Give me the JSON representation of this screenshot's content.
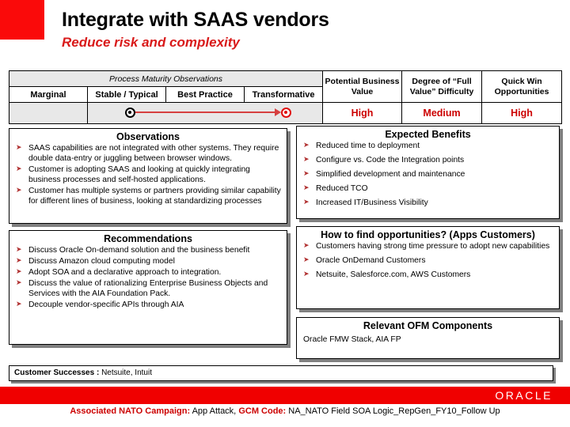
{
  "header": {
    "title": "Integrate with SAAS vendors",
    "subtitle": "Reduce risk and complexity",
    "accent_color": "#fa0a0a",
    "subtitle_color": "#d91a1a"
  },
  "maturity_table": {
    "group_header": "Process Maturity Observations",
    "stages": [
      "Marginal",
      "Stable / Typical",
      "Best Practice",
      "Transformative"
    ],
    "metric_headers": [
      "Potential Business Value",
      "Degree of “Full Value” Difficulty",
      "Quick Win Opportunities"
    ],
    "metric_values": [
      "High",
      "Medium",
      "High"
    ],
    "metric_value_color": "#cc0000",
    "current_stage": "Stable / Typical",
    "target_stage": "Transformative",
    "current_marker": "black-dot-marker",
    "target_marker": "red-dot-marker",
    "arrow": "progress-arrow"
  },
  "observations": {
    "title": "Observations",
    "items": [
      "SAAS capabilities are not integrated with other systems. They require double data-entry or juggling between browser windows.",
      "Customer is adopting SAAS and looking at quickly integrating business processes and self-hosted applications.",
      "Customer has multiple systems or partners providing similar capability for different lines of business, looking at standardizing processes"
    ]
  },
  "expected_benefits": {
    "title": "Expected Benefits",
    "items": [
      "Reduced time to deployment",
      "Configure vs. Code the Integration points",
      "Simplified development and maintenance",
      "Reduced TCO",
      "Increased IT/Business Visibility"
    ]
  },
  "recommendations": {
    "title": "Recommendations",
    "items": [
      "Discuss Oracle On-demand solution and the business benefit",
      "Discuss Amazon cloud computing model",
      "Adopt SOA and a declarative approach to integration.",
      "Discuss the value of rationalizing Enterprise Business Objects and Services with the AIA Foundation Pack.",
      "Decouple vendor-specific APIs through AIA"
    ]
  },
  "opportunities": {
    "title": "How to find opportunities? (Apps Customers)",
    "items": [
      "Customers having strong time pressure to adopt new capabilities",
      "Oracle OnDemand Customers",
      "Netsuite, Salesforce.com, AWS Customers"
    ]
  },
  "ofm_components": {
    "title": "Relevant OFM Components",
    "text": "Oracle FMW Stack, AIA FP"
  },
  "customer_successes": {
    "label": "Customer Successes :",
    "value": "Netsuite, Intuit"
  },
  "brand": {
    "wordmark": "ORACLE",
    "bar_color": "#f00000"
  },
  "footer": {
    "campaign_label": "Associated NATO Campaign:",
    "campaign_value": "App Attack,",
    "gcm_label": "GCM Code:",
    "gcm_value": "NA_NATO Field SOA Logic_RepGen_FY10_Follow Up"
  }
}
